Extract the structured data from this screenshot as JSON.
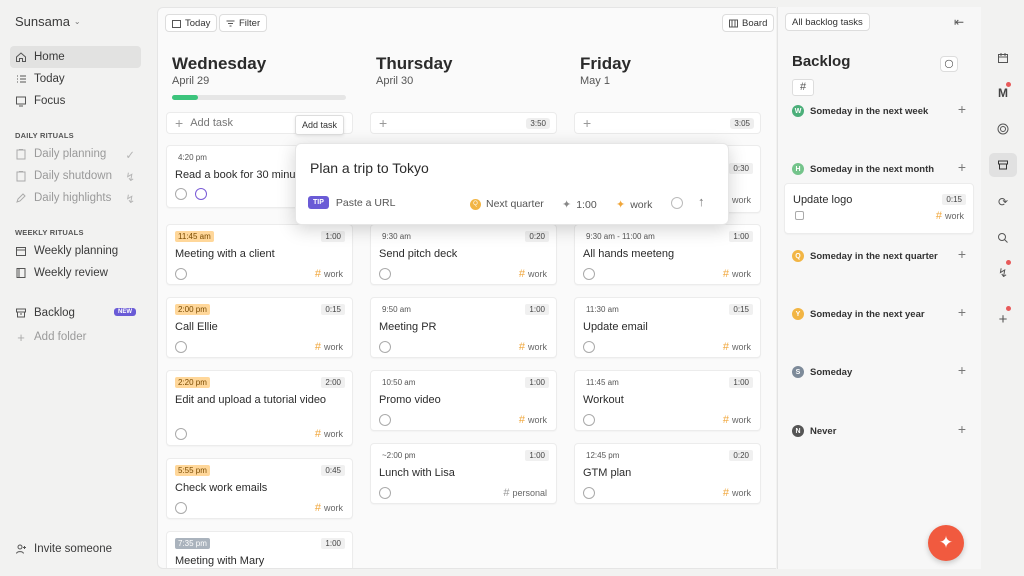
{
  "brand": {
    "name": "Sunsama"
  },
  "sidebar": {
    "nav": [
      {
        "label": "Home"
      },
      {
        "label": "Today"
      },
      {
        "label": "Focus"
      }
    ],
    "daily_title": "DAILY RITUALS",
    "daily": [
      {
        "label": "Daily planning"
      },
      {
        "label": "Daily shutdown"
      },
      {
        "label": "Daily highlights"
      }
    ],
    "weekly_title": "WEEKLY RITUALS",
    "weekly": [
      {
        "label": "Weekly planning"
      },
      {
        "label": "Weekly review"
      }
    ],
    "backlog_label": "Backlog",
    "new_badge": "NEW",
    "add_folder": "Add folder",
    "invite": "Invite someone"
  },
  "toolbar": {
    "today": "Today",
    "filter": "Filter",
    "board": "Board",
    "all_backlog": "All backlog tasks"
  },
  "days": [
    {
      "name": "Wednesday",
      "date": "April 29",
      "add_label": "Add task",
      "progress": 0.15
    },
    {
      "name": "Thursday",
      "date": "April 30",
      "total": "3:50"
    },
    {
      "name": "Friday",
      "date": "May 1",
      "total": "3:05"
    }
  ],
  "tooltip": "Add task",
  "popup": {
    "title": "Plan a trip to Tokyo",
    "tip": "TIP",
    "tip_text": "Paste a URL",
    "channel": "Next quarter",
    "duration": "1:00",
    "tag": "work"
  },
  "cards": {
    "wed": [
      {
        "time": "4:20 pm",
        "title": "Read a book for 30 minutes"
      },
      {
        "time": "11:45 am",
        "dur": "1:00",
        "title": "Meeting with a client",
        "tag": "work"
      },
      {
        "time": "2:00 pm",
        "dur": "0:15",
        "title": "Call Ellie",
        "tag": "work"
      },
      {
        "time": "2:20 pm",
        "dur": "2:00",
        "title": "Edit and upload a tutorial video",
        "tag": "work"
      },
      {
        "time": "5:55 pm",
        "dur": "0:45",
        "title": "Check work emails",
        "tag": "work"
      },
      {
        "time": "7:35 pm",
        "dur": "1:00",
        "title": "Meeting with Mary"
      }
    ],
    "thu": [
      {
        "time": "9:30 am",
        "dur": "0:20",
        "title": "Send pitch deck",
        "tag": "work"
      },
      {
        "time": "9:50 am",
        "dur": "1:00",
        "title": "Meeting PR",
        "tag": "work"
      },
      {
        "time": "10:50 am",
        "dur": "1:00",
        "title": "Promo video",
        "tag": "work"
      },
      {
        "time": "~2:00 pm",
        "dur": "1:00",
        "title": "Lunch with Lisa",
        "tag": "personal"
      }
    ],
    "fri": [
      {
        "dur": "0:30",
        "tag": "work"
      },
      {
        "time": "9:30 am - 11:00 am",
        "dur": "1:00",
        "title": "All hands meeteng",
        "tag": "work"
      },
      {
        "time": "11:30 am",
        "dur": "0:15",
        "title": "Update email",
        "tag": "work"
      },
      {
        "time": "11:45 am",
        "dur": "1:00",
        "title": "Workout",
        "tag": "work"
      },
      {
        "time": "12:45 pm",
        "dur": "0:20",
        "title": "GTM plan",
        "tag": "work"
      }
    ]
  },
  "backlog": {
    "title": "Backlog",
    "hash": "#",
    "groups": [
      {
        "letter": "W",
        "label": "Someday in the next week",
        "color": "#4caf7a"
      },
      {
        "letter": "H",
        "label": "Someday in the next month",
        "color": "#74c48b"
      },
      {
        "letter": "Q",
        "label": "Someday in the next quarter",
        "color": "#f2b544"
      },
      {
        "letter": "Y",
        "label": "Someday in the next year",
        "color": "#f2b544"
      },
      {
        "letter": "S",
        "label": "Someday",
        "color": "#7d8a99"
      },
      {
        "letter": "N",
        "label": "Never",
        "color": "#555555"
      }
    ],
    "item": {
      "title": "Update logo",
      "dur": "0:15",
      "tag": "work"
    }
  },
  "colors": {
    "accent": "#6a5bd6",
    "fab": "#f15a3f",
    "progress": "#3cc47c"
  }
}
